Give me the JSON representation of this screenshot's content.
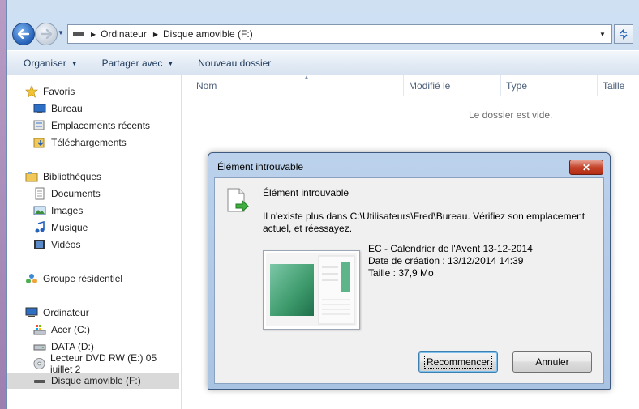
{
  "address": {
    "crumbs": [
      "Ordinateur",
      "Disque amovible (F:)"
    ]
  },
  "toolbar": {
    "organize": "Organiser",
    "share": "Partager avec",
    "new_folder": "Nouveau dossier"
  },
  "navpane": {
    "favorites": {
      "label": "Favoris",
      "items": [
        "Bureau",
        "Emplacements récents",
        "Téléchargements"
      ]
    },
    "libraries": {
      "label": "Bibliothèques",
      "items": [
        "Documents",
        "Images",
        "Musique",
        "Vidéos"
      ]
    },
    "homegroup": "Groupe résidentiel",
    "computer": {
      "label": "Ordinateur",
      "items": [
        "Acer (C:)",
        "DATA (D:)",
        "Lecteur DVD RW (E:) 05 juillet 2",
        "Disque amovible (F:)"
      ]
    }
  },
  "content": {
    "columns": [
      "Nom",
      "Modifié le",
      "Type",
      "Taille"
    ],
    "empty_message": "Le dossier est vide."
  },
  "dialog": {
    "title": "Élément introuvable",
    "close_label": "✕",
    "heading": "Élément introuvable",
    "message": "Il n'existe plus dans C:\\Utilisateurs\\Fred\\Bureau. Vérifiez son emplacement actuel, et réessayez.",
    "file_name": "EC - Calendrier de l'Avent 13-12-2014",
    "created": "Date de création : 13/12/2014 14:39",
    "size": "Taille : 37,9 Mo",
    "retry_label": "Recommencer",
    "cancel_label": "Annuler"
  }
}
